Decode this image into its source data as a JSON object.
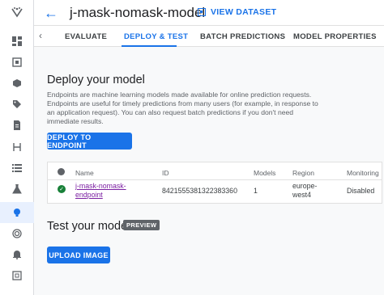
{
  "header": {
    "title": "j-mask-nomask-model",
    "view_dataset": "VIEW DATASET"
  },
  "tabs": [
    {
      "label": "EVALUATE"
    },
    {
      "label": "DEPLOY & TEST"
    },
    {
      "label": "BATCH PREDICTIONS"
    },
    {
      "label": "MODEL PROPERTIES"
    }
  ],
  "deploy": {
    "title": "Deploy your model",
    "description": "Endpoints are machine learning models made available for online prediction requests. Endpoints are useful for timely predictions from many users (for example, in response to an application request). You can also request batch predictions if you don't need immediate results.",
    "button": "DEPLOY TO ENDPOINT"
  },
  "table": {
    "headers": {
      "name": "Name",
      "id": "ID",
      "models": "Models",
      "region": "Region",
      "monitoring": "Monitoring"
    },
    "row": {
      "name_line1": "j-mask-nomask-",
      "name_line2": "endpoint",
      "id": "8421555381322383360",
      "models": "1",
      "region_line1": "europe-",
      "region_line2": "west4",
      "monitoring": "Disabled"
    }
  },
  "test": {
    "title": "Test your model",
    "badge": "PREVIEW",
    "button": "UPLOAD IMAGE"
  },
  "colors": {
    "accent": "#1a73e8",
    "success": "#188038",
    "link": "#7b1fa2"
  }
}
